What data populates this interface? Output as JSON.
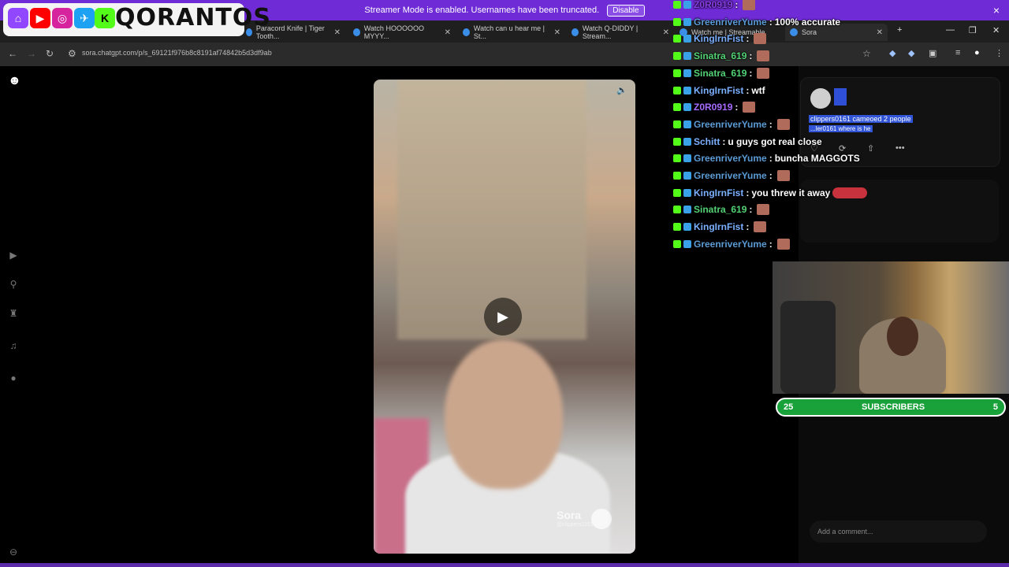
{
  "banner": {
    "text": "Streamer Mode is enabled. Usernames have been truncated.",
    "disable_label": "Disable",
    "close": "×"
  },
  "tabs": [
    {
      "title": "..."
    },
    {
      "title": "Paracord Knife | Tiger Tooth..."
    },
    {
      "title": "Watch HOOOOOO MYYY..."
    },
    {
      "title": "Watch can u hear me | St..."
    },
    {
      "title": "Watch Q-DIDDY | Stream..."
    },
    {
      "title": "Watch me | Streamable"
    },
    {
      "title": "Sora"
    }
  ],
  "browser": {
    "url": "sora.chatgpt.com/p/s_69121f976b8c8191af74842b5d3df9ab",
    "new_tab": "+"
  },
  "overlay": {
    "brand": "QORANTOS"
  },
  "chat": [
    {
      "user": "Z0R0919",
      "text": "",
      "color": "#8a3ee8",
      "emote": true
    },
    {
      "user": "GreenriverYume",
      "text": "100% accurate",
      "color": "#5b9bd5",
      "emote": false
    },
    {
      "user": "KingIrnFist",
      "text": "",
      "color": "#7ab0ff",
      "emote": true
    },
    {
      "user": "Sinatra_619",
      "text": "",
      "color": "#52d274",
      "emote": true
    },
    {
      "user": "Sinatra_619",
      "text": "",
      "color": "#52d274",
      "emote": true
    },
    {
      "user": "KingIrnFist",
      "text": "wtf",
      "color": "#7ab0ff",
      "emote": false
    },
    {
      "user": "Z0R0919",
      "text": "",
      "color": "#a86bff",
      "emote": true
    },
    {
      "user": "GreenriverYume",
      "text": "",
      "color": "#5b9bd5",
      "emote": true
    },
    {
      "user": "Schitt",
      "text": "u guys got real close",
      "color": "#7ab0ff",
      "emote": false
    },
    {
      "user": "GreenriverYume",
      "text": "buncha MAGGOTS",
      "color": "#5b9bd5",
      "emote": false
    },
    {
      "user": "GreenriverYume",
      "text": "",
      "color": "#5b9bd5",
      "emote": true
    },
    {
      "user": "KingIrnFist",
      "text": "you threw it away",
      "color": "#7ab0ff",
      "emote": false,
      "car": true
    },
    {
      "user": "Sinatra_619",
      "text": "",
      "color": "#52d274",
      "emote": true
    },
    {
      "user": "KingIrnFist",
      "text": "",
      "color": "#7ab0ff",
      "emote": true
    },
    {
      "user": "GreenriverYume",
      "text": "",
      "color": "#5b9bd5",
      "emote": true
    }
  ],
  "post": {
    "cameo_line": "clippers0161 cameoed 2 people",
    "comment_line": "...ler0161 where is he",
    "comment_placeholder": "Add a comment...",
    "watermark": "Sora",
    "watermark_handle": "@clippers0161"
  },
  "subs": {
    "left": "25",
    "label": "SUBSCRIBERS",
    "right": "5"
  }
}
